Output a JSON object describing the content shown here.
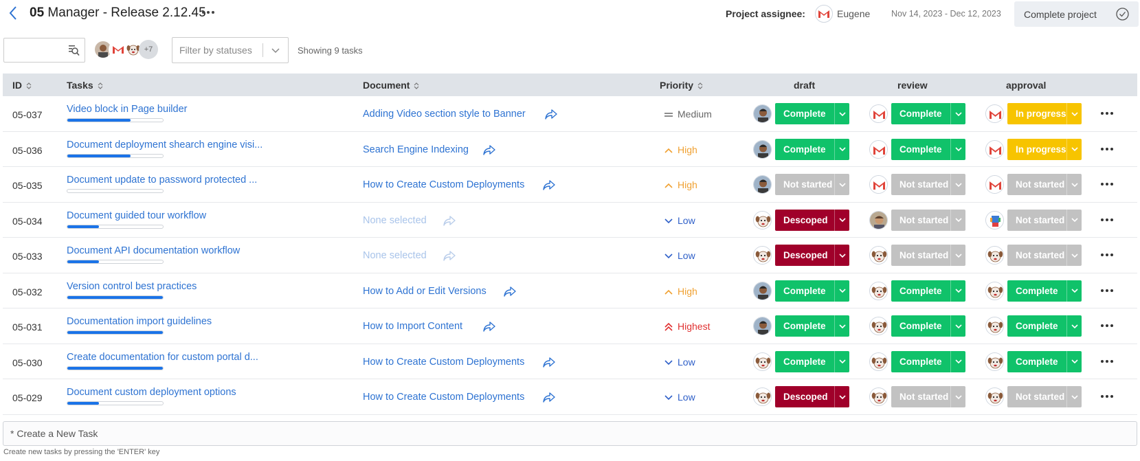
{
  "header": {
    "title_id": "05",
    "title_rest": "Manager - Release 2.12.45",
    "assignee_label": "Project assignee:",
    "assignee_name": "Eugene",
    "date_range": "Nov 14, 2023 - Dec 12, 2023",
    "complete_button": "Complete project"
  },
  "filters": {
    "search_placeholder": "",
    "more_users": "+7",
    "status_placeholder": "Filter by statuses",
    "showing": "Showing 9 tasks"
  },
  "columns": {
    "id": "ID",
    "tasks": "Tasks",
    "document": "Document",
    "priority": "Priority",
    "draft": "draft",
    "review": "review",
    "approval": "approval"
  },
  "colors": {
    "complete": "#10c26a",
    "in_progress": "#f7c400",
    "not_started": "#c2c2c2",
    "descoped": "#a0002a",
    "link": "#2e73d2",
    "high": "#f0a030",
    "highest": "#e03030",
    "low": "#2e5fc8",
    "medium": "#666666"
  },
  "rows": [
    {
      "id": "05-037",
      "task": "Video block in Page builder",
      "progress": 0.66,
      "doc": "Adding Video section style to Banner",
      "doc_none": false,
      "priority": "Medium",
      "pkey": "medium",
      "draft": {
        "status": "Complete",
        "key": "complete",
        "avatar": "man-avatar"
      },
      "review": {
        "status": "Complete",
        "key": "complete",
        "avatar": "gmail-avatar"
      },
      "approval": {
        "status": "In progress",
        "key": "in_progress",
        "avatar": "gmail-avatar"
      }
    },
    {
      "id": "05-036",
      "task": "Document deployment shearch engine visi...",
      "progress": 0.66,
      "doc": "Search Engine Indexing",
      "doc_none": false,
      "priority": "High",
      "pkey": "high",
      "draft": {
        "status": "Complete",
        "key": "complete",
        "avatar": "man-avatar"
      },
      "review": {
        "status": "Complete",
        "key": "complete",
        "avatar": "gmail-avatar"
      },
      "approval": {
        "status": "In progress",
        "key": "in_progress",
        "avatar": "gmail-avatar"
      }
    },
    {
      "id": "05-035",
      "task": "Document update to password protected ...",
      "progress": 0.0,
      "doc": "How to Create Custom Deployments",
      "doc_none": false,
      "priority": "High",
      "pkey": "high",
      "draft": {
        "status": "Not started",
        "key": "not_started",
        "avatar": "man-avatar"
      },
      "review": {
        "status": "Not started",
        "key": "not_started",
        "avatar": "gmail-avatar"
      },
      "approval": {
        "status": "Not started",
        "key": "not_started",
        "avatar": "gmail-avatar"
      }
    },
    {
      "id": "05-034",
      "task": "Document guided tour workflow",
      "progress": 0.33,
      "doc": "None selected",
      "doc_none": true,
      "priority": "Low",
      "pkey": "low",
      "draft": {
        "status": "Descoped",
        "key": "descoped",
        "avatar": "dog-avatar"
      },
      "review": {
        "status": "Not started",
        "key": "not_started",
        "avatar": "man2-avatar"
      },
      "approval": {
        "status": "Not started",
        "key": "not_started",
        "avatar": "robot-avatar"
      }
    },
    {
      "id": "05-033",
      "task": "Document API documentation workflow",
      "progress": 0.33,
      "doc": "None selected",
      "doc_none": true,
      "priority": "Low",
      "pkey": "low",
      "draft": {
        "status": "Descoped",
        "key": "descoped",
        "avatar": "dog-avatar"
      },
      "review": {
        "status": "Not started",
        "key": "not_started",
        "avatar": "dog-avatar"
      },
      "approval": {
        "status": "Not started",
        "key": "not_started",
        "avatar": "dog-avatar"
      }
    },
    {
      "id": "05-032",
      "task": "Version control best practices",
      "progress": 1.0,
      "doc": "How to Add or Edit Versions",
      "doc_none": false,
      "priority": "High",
      "pkey": "high",
      "draft": {
        "status": "Complete",
        "key": "complete",
        "avatar": "man-avatar"
      },
      "review": {
        "status": "Complete",
        "key": "complete",
        "avatar": "dog-avatar"
      },
      "approval": {
        "status": "Complete",
        "key": "complete",
        "avatar": "dog-avatar"
      }
    },
    {
      "id": "05-031",
      "task": "Documentation import guidelines",
      "progress": 1.0,
      "doc": "How to Import Content",
      "doc_none": false,
      "priority": "Highest",
      "pkey": "highest",
      "draft": {
        "status": "Complete",
        "key": "complete",
        "avatar": "man-avatar"
      },
      "review": {
        "status": "Complete",
        "key": "complete",
        "avatar": "dog-avatar"
      },
      "approval": {
        "status": "Complete",
        "key": "complete",
        "avatar": "dog-avatar"
      }
    },
    {
      "id": "05-030",
      "task": "Create documentation for custom portal d...",
      "progress": 1.0,
      "doc": "How to Create Custom Deployments",
      "doc_none": false,
      "priority": "Low",
      "pkey": "low",
      "draft": {
        "status": "Complete",
        "key": "complete",
        "avatar": "dog-avatar"
      },
      "review": {
        "status": "Complete",
        "key": "complete",
        "avatar": "dog-avatar"
      },
      "approval": {
        "status": "Complete",
        "key": "complete",
        "avatar": "dog-avatar"
      }
    },
    {
      "id": "05-029",
      "task": "Document custom deployment options",
      "progress": 0.33,
      "doc": "How to Create Custom Deployments",
      "doc_none": false,
      "priority": "Low",
      "pkey": "low",
      "draft": {
        "status": "Descoped",
        "key": "descoped",
        "avatar": "dog-avatar"
      },
      "review": {
        "status": "Not started",
        "key": "not_started",
        "avatar": "dog-avatar"
      },
      "approval": {
        "status": "Not started",
        "key": "not_started",
        "avatar": "dog-avatar"
      }
    }
  ],
  "new_task": {
    "placeholder": "* Create a New Task",
    "hint": "Create new tasks by pressing the 'ENTER' key"
  }
}
